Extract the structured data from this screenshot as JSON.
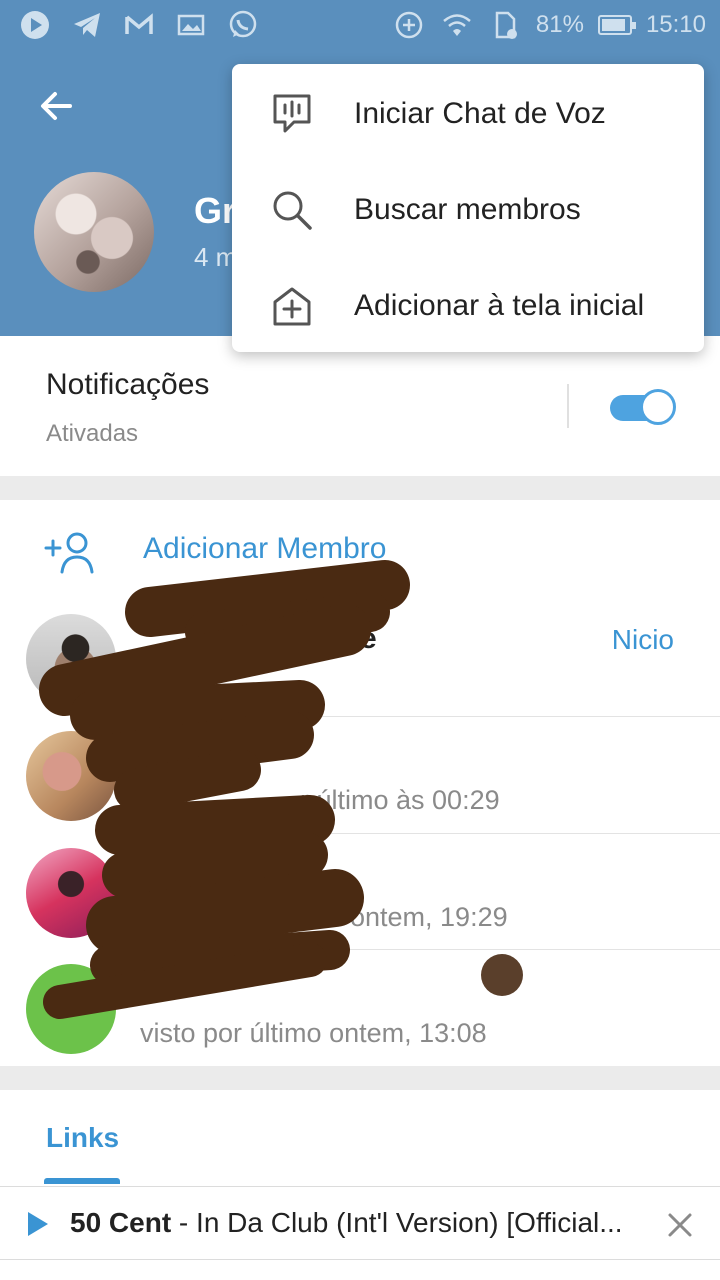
{
  "status_bar": {
    "left_icons": [
      "play-icon",
      "telegram-icon",
      "gmail-icon",
      "gallery-icon",
      "whatsapp-icon"
    ],
    "battery": "81%",
    "time": "15:10"
  },
  "header": {
    "group_title": "Gr",
    "member_count": "4 m",
    "background": "#5a8fbd"
  },
  "menu": {
    "items": [
      {
        "label": "Iniciar Chat de Voz",
        "icon": "voice-chat-icon"
      },
      {
        "label": "Buscar membros",
        "icon": "search-icon"
      },
      {
        "label": "Adicionar à tela inicial",
        "icon": "add-home-icon"
      }
    ]
  },
  "notifications": {
    "title": "Notificações",
    "status": "Ativadas",
    "enabled": true
  },
  "members": {
    "add_label": "Adicionar Membro",
    "rows": [
      {
        "name": "e",
        "status": "",
        "role": "Nicio"
      },
      {
        "name": "",
        "status": "r último às 00:29",
        "role": ""
      },
      {
        "name": "",
        "status": "ontem, 19:29",
        "role": ""
      },
      {
        "name": "",
        "status": "visto por último ontem, 13:08",
        "role": ""
      }
    ]
  },
  "links": {
    "tab_label": "Links"
  },
  "player": {
    "artist": "50 Cent",
    "title": " - In Da Club (Int'l Version) [Official..."
  },
  "colors": {
    "accent": "#3a94d3",
    "header": "#5a8fbd",
    "redaction": "#4a2a12",
    "online_avatar": "#6cc24a"
  }
}
